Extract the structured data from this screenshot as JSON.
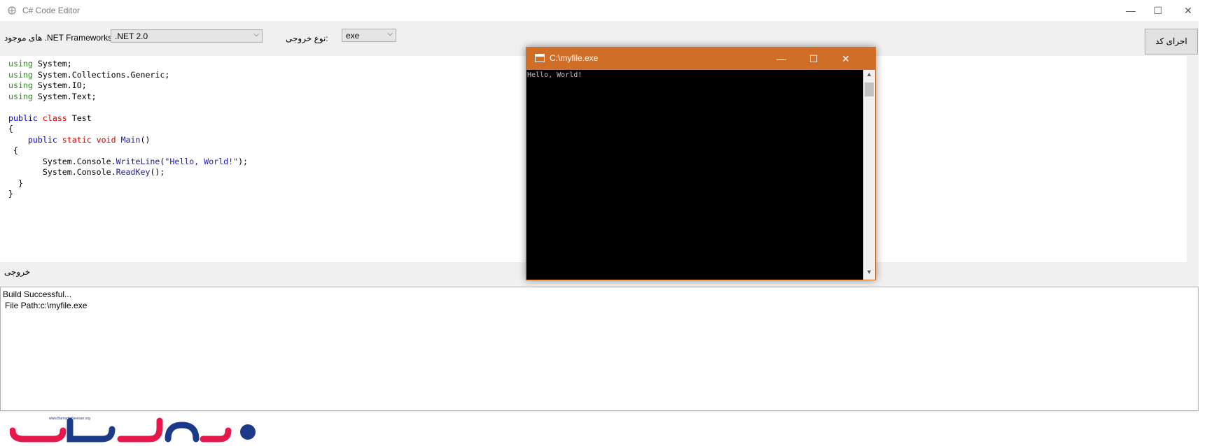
{
  "window": {
    "title": "C# Code Editor",
    "minimize": "—",
    "maximize": "☐",
    "close": "✕"
  },
  "toolbar": {
    "framework_label": "هاى موجود .NET Frameworks:",
    "framework_value": ".NET 2.0",
    "output_type_label": "نوع خروجى:",
    "output_type_value": "exe",
    "run_button": "اجراى كد"
  },
  "editor": {
    "code_lines": [
      "using System;",
      "using System.Collections.Generic;",
      "using System.IO;",
      "using System.Text;",
      "",
      "public class Test",
      "{",
      "    public static void Main()",
      " {",
      "       System.Console.WriteLine(\"Hello, World!\");",
      "       System.Console.ReadKey();",
      "  }",
      "}"
    ]
  },
  "output": {
    "label": "خروجى",
    "lines": [
      "Build Successful...",
      "File Path:c:\\myfile.exe"
    ]
  },
  "console": {
    "title": "C:\\myfile.exe",
    "text": "Hello, World!",
    "minimize": "—",
    "maximize": "☐",
    "close": "✕"
  },
  "logo": {
    "tagline": "www.BarnameNevisan.org"
  },
  "icons": {
    "app": "app-icon",
    "console": "console-icon",
    "chevron": "chevron-down-icon"
  },
  "colors": {
    "console_titlebar": "#d06e27",
    "keyword_using": "#2e8b22",
    "keyword_public": "#0000c8",
    "keyword_type": "#c80000",
    "logo_red": "#e8174a",
    "logo_blue": "#1d3a8a"
  }
}
